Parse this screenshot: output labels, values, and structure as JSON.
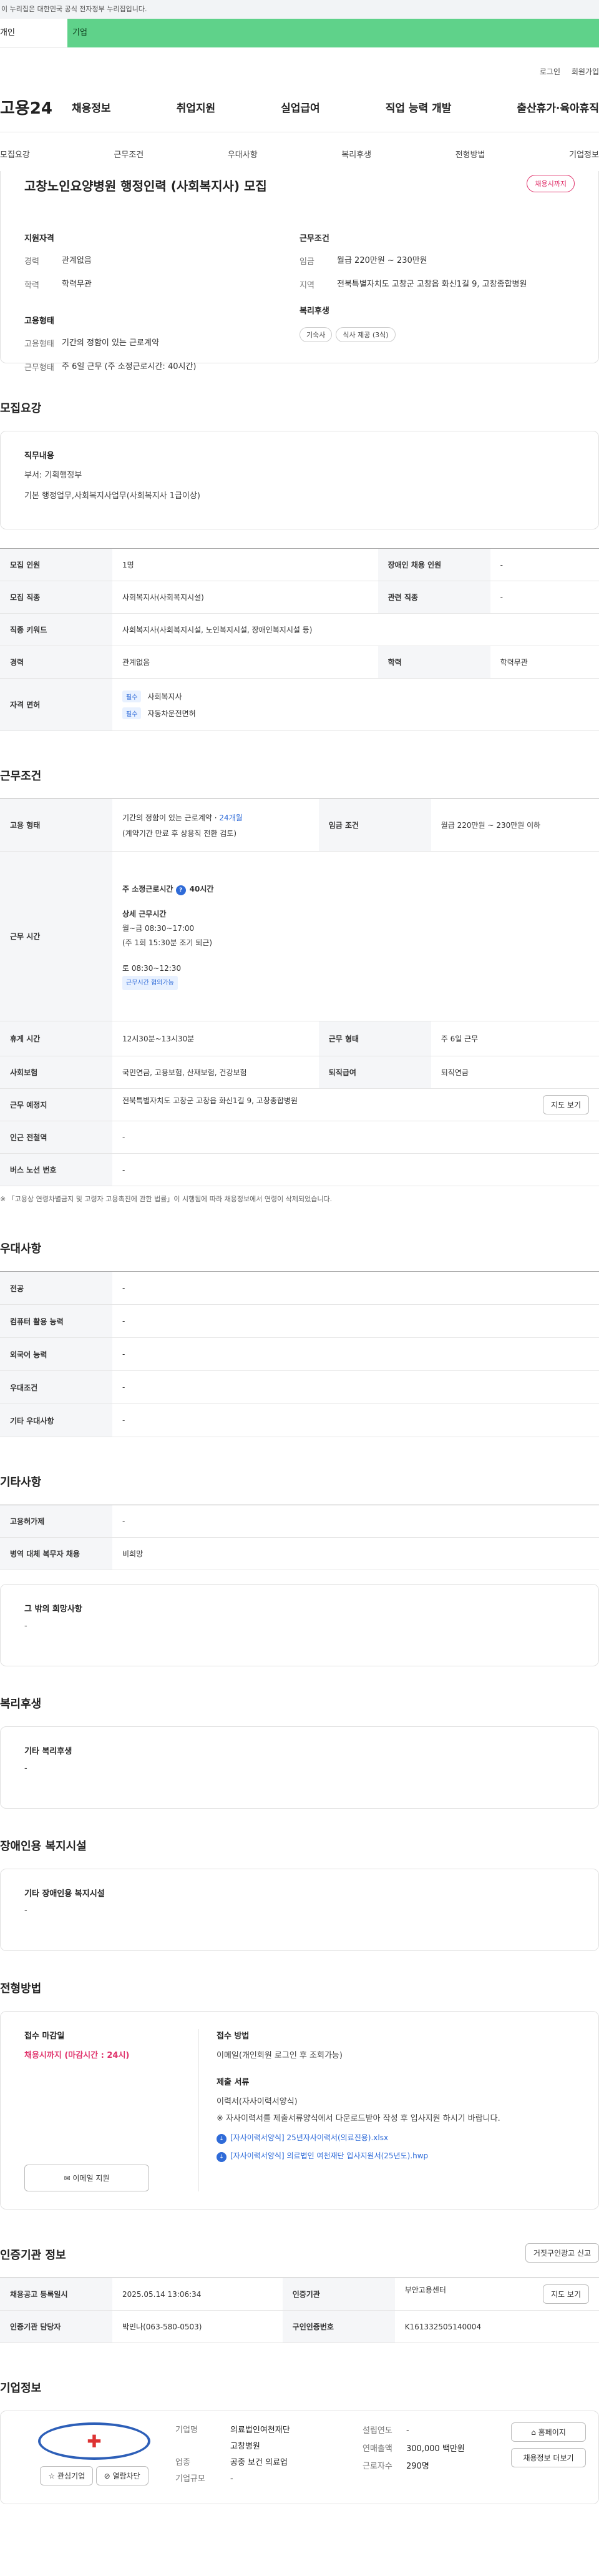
{
  "topbar": {
    "notice": "이 누리집은 대한민국 공식 전자정부 누리집입니다."
  },
  "user_type": {
    "tab1": "개인",
    "tab2": "기업"
  },
  "util": {
    "login": "로그인",
    "join": "회원가입"
  },
  "gnb": {
    "logo": "고용24",
    "menu": [
      "채용정보",
      "취업지원",
      "실업급여",
      "직업 능력 개발",
      "출산휴가·육아휴직"
    ]
  },
  "anchor": [
    "모집요강",
    "근무조건",
    "우대사항",
    "복리후생",
    "전형방법",
    "기업정보"
  ],
  "summary": {
    "title": "고창노인요양병원 행정인력 (사회복지사) 모집",
    "badge": "채용시까지",
    "qual_h": "지원자격",
    "career_k": "경력",
    "career_v": "관계없음",
    "edu_k": "학력",
    "edu_v": "학력무관",
    "emp_h": "고용형태",
    "emptype_k": "고용형태",
    "emptype_v": "기간의 정함이 있는 근로계약",
    "wk_k": "근무형태",
    "wk_v": "주 6일 근무 (주 소정근로시간: 40시간)",
    "cond_h": "근무조건",
    "wage_k": "임금",
    "wage_v": "월급 220만원 ~ 230만원",
    "area_k": "지역",
    "area_v": "전북특별자치도 고창군 고창읍 화신1길 9, 고창종합병원",
    "ben_h": "복리후생",
    "ben_tags": [
      "기숙사",
      "식사 제공 (3식)"
    ]
  },
  "recruit": {
    "title": "모집요강",
    "job_h": "직무내용",
    "dept": "부서: 기획행정부",
    "job": "기본 행정업무,사회복지사업무(사회복지사 1급이상)",
    "rows": {
      "cnt_k": "모집 인원",
      "cnt_v": "1명",
      "dis_k": "장애인 채용 인원",
      "dis_v": "-",
      "occ_k": "모집 직종",
      "occ_v": "사회복지사(사회복지시설)",
      "rel_k": "관련 직종",
      "rel_v": "-",
      "kw_k": "직종 키워드",
      "kw_v": "사회복지사(사회복지시설, 노인복지시설, 장애인복지시설 등)",
      "car_k": "경력",
      "car_v": "관계없음",
      "edu_k": "학력",
      "edu_v": "학력무관",
      "lic_k": "자격 면허",
      "lic_tag": "필수",
      "lic1": "사회복지사",
      "lic2": "자동차운전면허"
    }
  },
  "work": {
    "title": "근무조건",
    "emp_k": "고용 형태",
    "emp_v1": "기간의 정함이 있는 근로계약 · ",
    "emp_v1b": "24개월",
    "emp_v2": "(계약기간 만료 후 상용직 전환 검토)",
    "wage_k": "임금 조건",
    "wage_v": "월급 220만원 ~ 230만원 이하",
    "time_k": "근무 시간",
    "time_h": "주 소정근로시간",
    "time_hv": "40시간",
    "detail_h": "상세 근무시간",
    "d1": "월~금 08:30~17:00",
    "d2": "(주 1회 15:30분 조기 퇴근)",
    "d3": "토 08:30~12:30",
    "flex": "근무시간 협의가능",
    "rest_k": "휴게 시간",
    "rest_v": "12시30분~13시30분",
    "type_k": "근무 형태",
    "type_v": "주 6일 근무",
    "ins_k": "사회보험",
    "ins_v": "국민연금, 고용보험, 산재보험, 건강보험",
    "ret_k": "퇴직급여",
    "ret_v": "퇴직연금",
    "place_k": "근무 예정지",
    "place_v": "전북특별자치도 고창군 고창읍 화신1길 9, 고창종합병원",
    "map_btn": "지도 보기",
    "sub_k": "인근 전철역",
    "sub_v": "-",
    "bus_k": "버스 노선 번호",
    "bus_v": "-",
    "note": "※ 「고용상 연령차별금지 및 고령자 고용촉진에 관한 법률」이 시행됨에 따라 채용정보에서 연령이 삭제되었습니다."
  },
  "prefer": {
    "title": "우대사항",
    "rows": [
      [
        "전공",
        "-"
      ],
      [
        "컴퓨터 활용 능력",
        "-"
      ],
      [
        "외국어 능력",
        "-"
      ],
      [
        "우대조건",
        "-"
      ],
      [
        "기타 우대사항",
        "-"
      ]
    ]
  },
  "etc": {
    "title": "기타사항",
    "r1k": "고용허가제",
    "r1v": "-",
    "r2k": "병역 대체 복무자 채용",
    "r2v": "비희망",
    "box_h": "그 밖의 희망사항",
    "box_v": "-"
  },
  "welfare": {
    "title": "복리후생",
    "box_h": "기타 복리후생",
    "box_v": "-"
  },
  "facility": {
    "title": "장애인용 복지시설",
    "box_h": "기타 장애인용 복지시설",
    "box_v": "-"
  },
  "apply": {
    "title": "전형방법",
    "dead_h": "접수 마감일",
    "dead_v": "채용시까지 (마감시간 : 24시)",
    "email_btn": "이메일 지원",
    "method_h": "접수 방법",
    "method_v": "이메일(개인회원 로그인 후 조회가능)",
    "doc_h": "제출 서류",
    "doc1": "이력서(자사이력서양식)",
    "doc2": "※ 자사이력서를 제출서류양식에서 다운로드받아 작성 후 입사지원 하시기 바랍니다.",
    "f1": "[자사이력서양식] 25년자사이력서(의료진용).xlsx",
    "f2": "[자사이력서양식] 의료법인 여천재단 입사지원서(25년도).hwp"
  },
  "cert": {
    "title": "인증기관 정보",
    "report_btn": "거짓구인광고 신고",
    "reg_k": "채용공고 등록일시",
    "reg_v": "2025.05.14 13:06:34",
    "org_k": "인증기관",
    "org_v": "부안고용센터",
    "map_btn": "지도 보기",
    "mgr_k": "인증기관 담당자",
    "mgr_v": "박민나(063-580-0503)",
    "no_k": "구인인증번호",
    "no_v": "K161332505140004"
  },
  "company": {
    "title": "기업정보",
    "fav": "관심기업",
    "block": "열람차단",
    "name_k": "기업명",
    "name_v1": "의료법인여천재단",
    "name_v2": "고창병원",
    "ind_k": "업종",
    "ind_v1": "공중 보건 의료업",
    "scale_k": "기업규모",
    "scale_v": "-",
    "est_k": "설립연도",
    "est_v": "-",
    "sales_k": "연매출액",
    "sales_v": "300,000 백만원",
    "emp_k": "근로자수",
    "emp_v": "290명",
    "home_btn": "홈페이지",
    "more_btn": "채용정보 더보기"
  }
}
